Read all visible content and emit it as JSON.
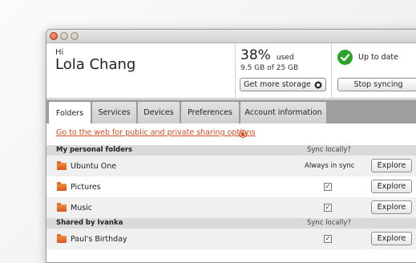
{
  "header": {
    "greeting": "Hi",
    "user_name": "Lola Chang",
    "storage_percent": "38%",
    "storage_used_suffix": "used",
    "storage_detail": "9.5 GB of 25 GB",
    "more_storage_label": "Get more storage",
    "status_text": "Up to date",
    "stop_sync_label": "Stop syncing"
  },
  "tabs": [
    {
      "label": "Folders",
      "active": true
    },
    {
      "label": "Services"
    },
    {
      "label": "Devices"
    },
    {
      "label": "Preferences"
    },
    {
      "label": "Account information"
    }
  ],
  "folders": {
    "web_link": "Go to the web for public and private sharing options",
    "sections": [
      {
        "title": "My personal folders",
        "sync_header": "Sync locally?",
        "rows": [
          {
            "name": "Ubuntu One",
            "sync": "Always in sync",
            "action": "Explore"
          },
          {
            "name": "Pictures",
            "sync": "✓",
            "action": "Explore"
          },
          {
            "name": "Music",
            "sync": "✓",
            "action": "Explore"
          }
        ]
      },
      {
        "title": "Shared by Ivanka",
        "sync_header": "Sync locally?",
        "rows": [
          {
            "name": "Paul's Birthday",
            "sync": "✓",
            "action": "Explore"
          }
        ]
      }
    ]
  },
  "colors": {
    "accent": "#d44a1e",
    "status_ok": "#2aa52a",
    "folder": "#e8702a"
  }
}
